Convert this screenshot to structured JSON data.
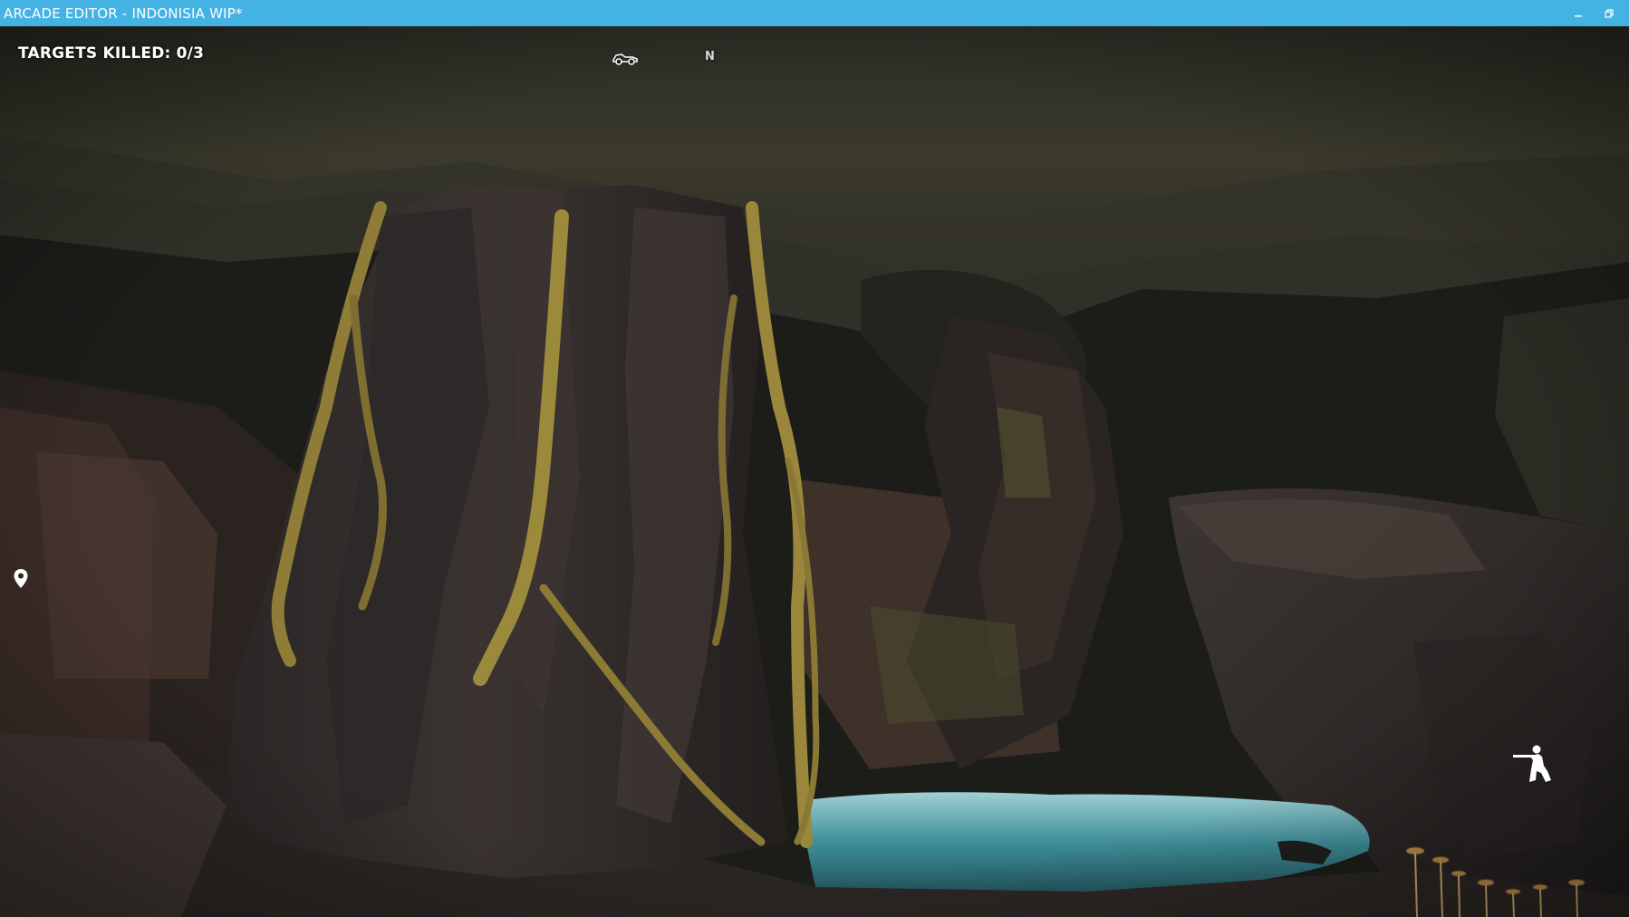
{
  "window": {
    "title": "ARCADE EDITOR - INDONISIA WIP*",
    "minimize_icon": "minimize-icon",
    "restore_icon": "restore-icon"
  },
  "hud": {
    "targets_killed": "TARGETS KILLED: 0/3",
    "compass_heading": "N",
    "vehicle_icon": "vehicle-icon",
    "waypoint_icon": "map-marker-icon",
    "stance_icon": "soldier-aiming-icon"
  },
  "colors": {
    "titlebar": "#45b2e4",
    "hud_text": "#ffffff"
  }
}
